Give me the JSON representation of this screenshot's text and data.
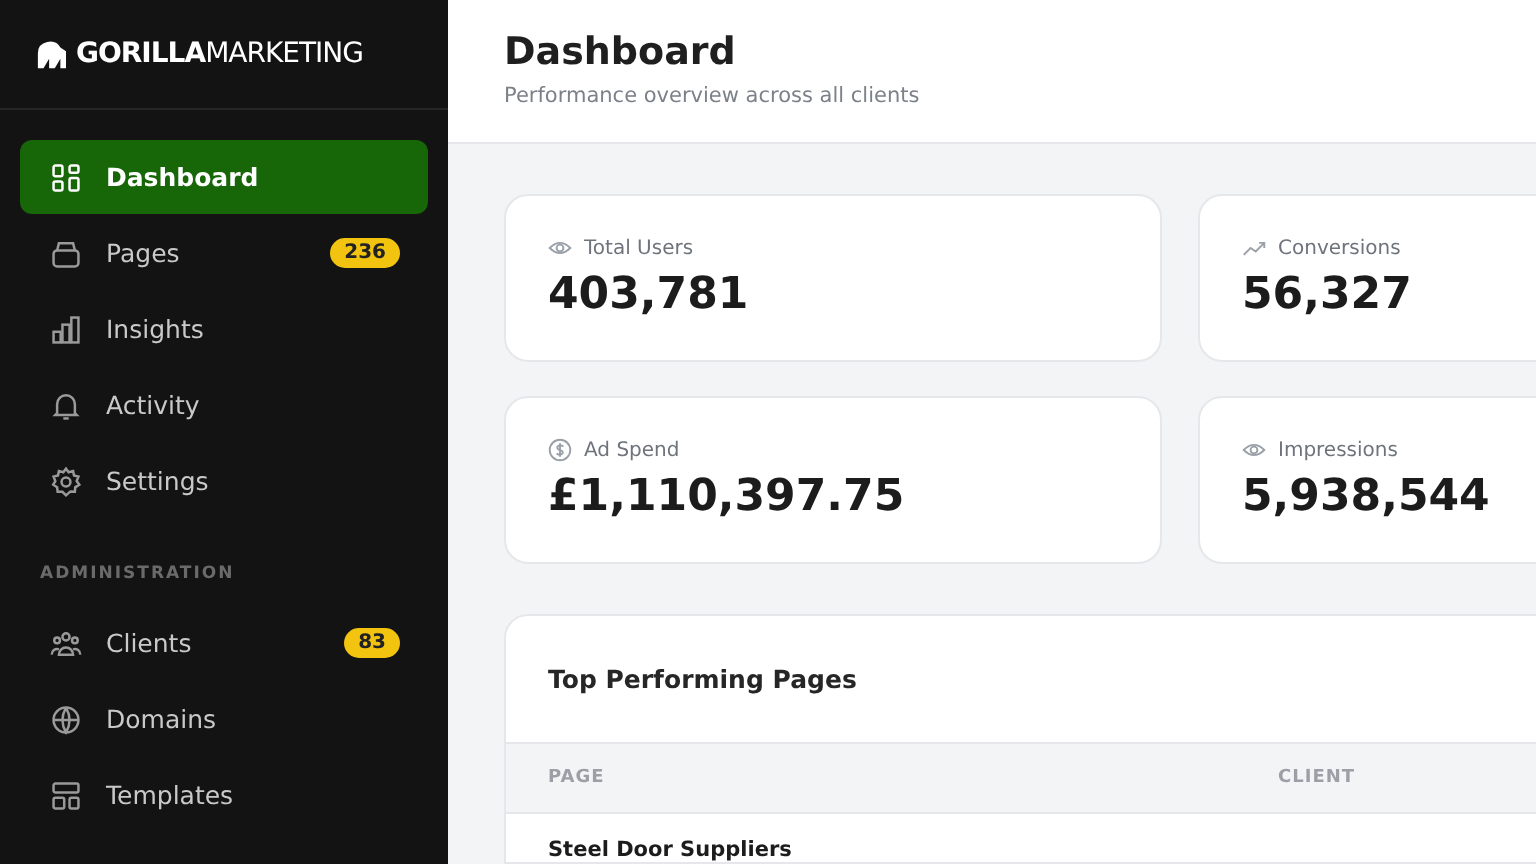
{
  "brand": {
    "bold": "GORILLA",
    "light": "MARKETING"
  },
  "sidebar": {
    "items": [
      {
        "label": "Dashboard",
        "selected": true
      },
      {
        "label": "Pages",
        "selected": false,
        "badge": "236"
      },
      {
        "label": "Insights",
        "selected": false
      },
      {
        "label": "Activity",
        "selected": false
      },
      {
        "label": "Settings",
        "selected": false
      }
    ],
    "section": "ADMINISTRATION",
    "admin_items": [
      {
        "label": "Clients",
        "selected": false,
        "badge": "83"
      },
      {
        "label": "Domains",
        "selected": false
      },
      {
        "label": "Templates",
        "selected": false
      }
    ]
  },
  "header": {
    "title": "Dashboard",
    "subtitle": "Performance overview across all clients"
  },
  "stats": [
    {
      "label": "Total Users",
      "value": "403,781"
    },
    {
      "label": "Conversions",
      "value": "56,327"
    },
    {
      "label": "Ad Spend",
      "value": "£1,110,397.75"
    },
    {
      "label": "Impressions",
      "value": "5,938,544"
    }
  ],
  "table": {
    "title": "Top Performing Pages",
    "columns": [
      "PAGE",
      "CLIENT"
    ],
    "rows": [
      [
        "Steel Door Suppliers"
      ]
    ]
  }
}
